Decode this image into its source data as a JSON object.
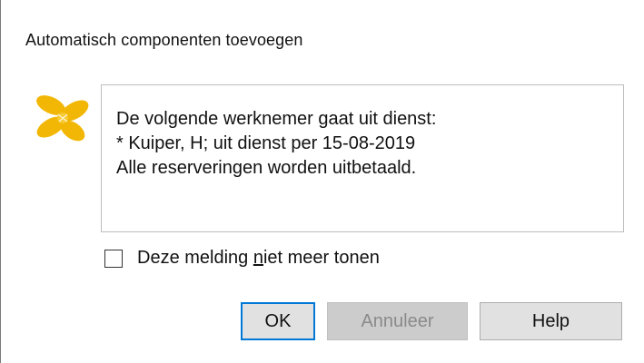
{
  "window": {
    "title": "Automatisch componenten toevoegen"
  },
  "message": {
    "lines": [
      "De volgende werknemer gaat uit dienst:",
      "* Kuiper, H; uit dienst per 15-08-2019",
      "Alle reserveringen worden uitbetaald."
    ]
  },
  "checkbox": {
    "label_before": "Deze melding ",
    "label_underlined": "n",
    "label_after": "iet meer tonen",
    "checked": false
  },
  "buttons": {
    "ok": "OK",
    "cancel": "Annuleer",
    "help": "Help"
  },
  "colors": {
    "icon_gold": "#f2b705",
    "focus_border": "#0078d7",
    "disabled_text": "#8a8a8a"
  },
  "icons": {
    "app_icon": "yellow-propeller-logo"
  }
}
